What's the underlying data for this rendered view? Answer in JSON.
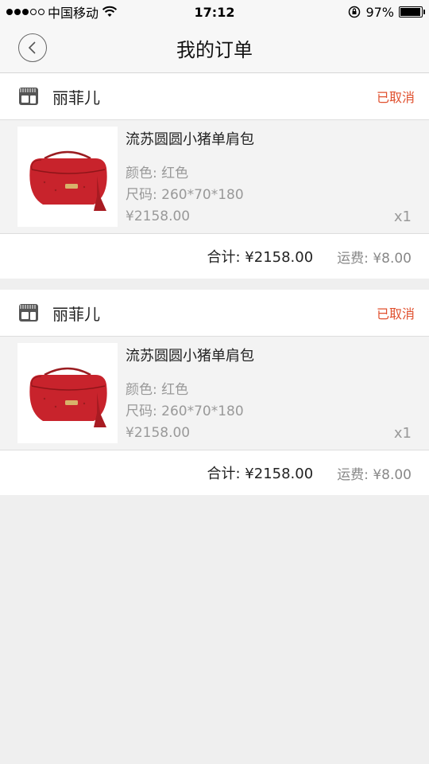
{
  "status_bar": {
    "carrier": "中国移动",
    "time": "17:12",
    "battery_percent": "97%",
    "battery_level": 0.97
  },
  "nav": {
    "title": "我的订单",
    "back_icon": "chevron-left-icon"
  },
  "orders": [
    {
      "shop_name": "丽菲儿",
      "status": "已取消",
      "product": {
        "name": "流苏圆圆小猪单肩包",
        "color": "颜色: 红色",
        "size": "尺码: 260*70*180",
        "price": "¥2158.00",
        "quantity": "x1"
      },
      "total": "合计: ¥2158.00",
      "shipping": "运费: ¥8.00"
    },
    {
      "shop_name": "丽菲儿",
      "status": "已取消",
      "product": {
        "name": "流苏圆圆小猪单肩包",
        "color": "颜色: 红色",
        "size": "尺码: 260*70*180",
        "price": "¥2158.00",
        "quantity": "x1"
      },
      "total": "合计: ¥2158.00",
      "shipping": "运费: ¥8.00"
    }
  ],
  "colors": {
    "status_cancelled": "#e0502e",
    "bag_red": "#c8232c"
  }
}
